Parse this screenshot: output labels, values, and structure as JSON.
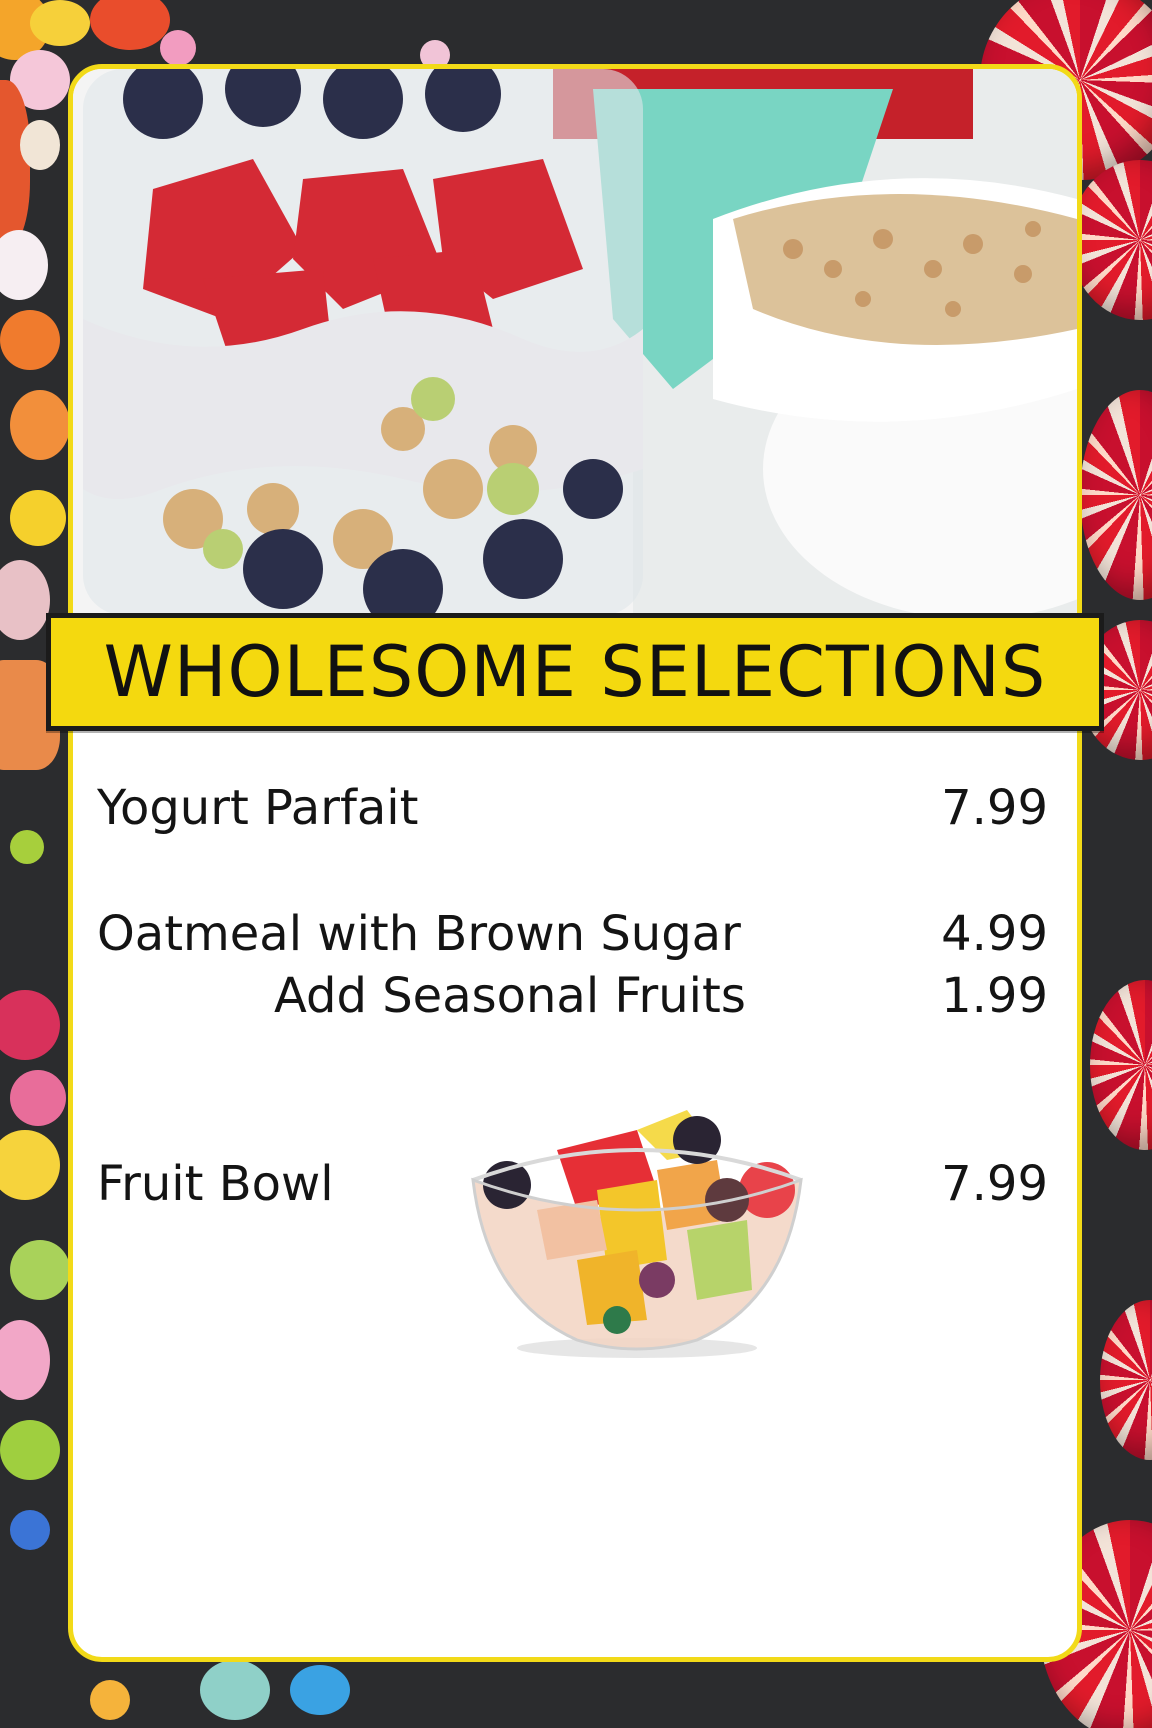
{
  "menu": {
    "title": "WHOLESOME SELECTIONS",
    "items": [
      {
        "name": "Yogurt Parfait",
        "price": "7.99"
      },
      {
        "name": "Oatmeal with Brown Sugar",
        "price": "4.99"
      },
      {
        "name": "Add Seasonal Fruits",
        "price": "1.99"
      },
      {
        "name": "Fruit Bowl",
        "price": "7.99"
      }
    ]
  },
  "colors": {
    "accent_yellow": "#f4d90f",
    "card_border": "#f2da18",
    "text": "#141414",
    "background": "#2b2c2e"
  },
  "images": {
    "hero": "yogurt-parfait-jar-photo",
    "item_photo": "fruit-bowl-photo",
    "background": "candy-and-lollipops-photo"
  }
}
